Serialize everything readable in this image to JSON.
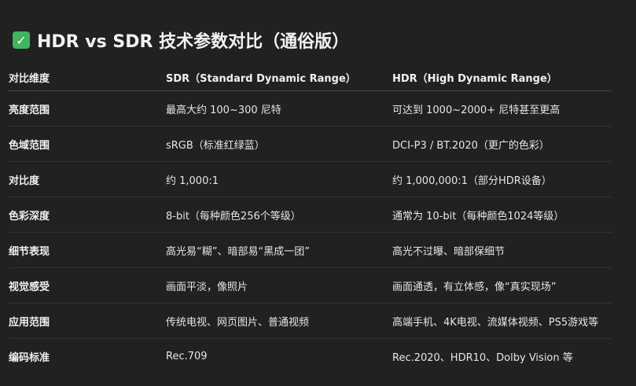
{
  "title": {
    "icon": "check-mark-icon",
    "text": "HDR vs SDR 技术参数对比（通俗版）"
  },
  "table": {
    "headers": [
      "对比维度",
      "SDR（Standard Dynamic Range）",
      "HDR（High Dynamic Range）"
    ],
    "rows": [
      [
        "亮度范围",
        "最高大约 100~300 尼特",
        "可达到 1000~2000+ 尼特甚至更高"
      ],
      [
        "色域范围",
        "sRGB（标准红绿蓝）",
        "DCI-P3 / BT.2020（更广的色彩）"
      ],
      [
        "对比度",
        "约 1,000:1",
        "约 1,000,000:1（部分HDR设备）"
      ],
      [
        "色彩深度",
        "8-bit（每种颜色256个等级）",
        "通常为 10-bit（每种颜色1024等级）"
      ],
      [
        "细节表现",
        "高光易“糊”、暗部易“黑成一团”",
        "高光不过曝、暗部保细节"
      ],
      [
        "视觉感受",
        "画面平淡，像照片",
        "画面通透，有立体感，像“真实现场”"
      ],
      [
        "应用范围",
        "传统电视、网页图片、普通视频",
        "高端手机、4K电视、流媒体视频、PS5游戏等"
      ],
      [
        "编码标准",
        "Rec.709",
        "Rec.2020、HDR10、Dolby Vision 等"
      ]
    ]
  }
}
